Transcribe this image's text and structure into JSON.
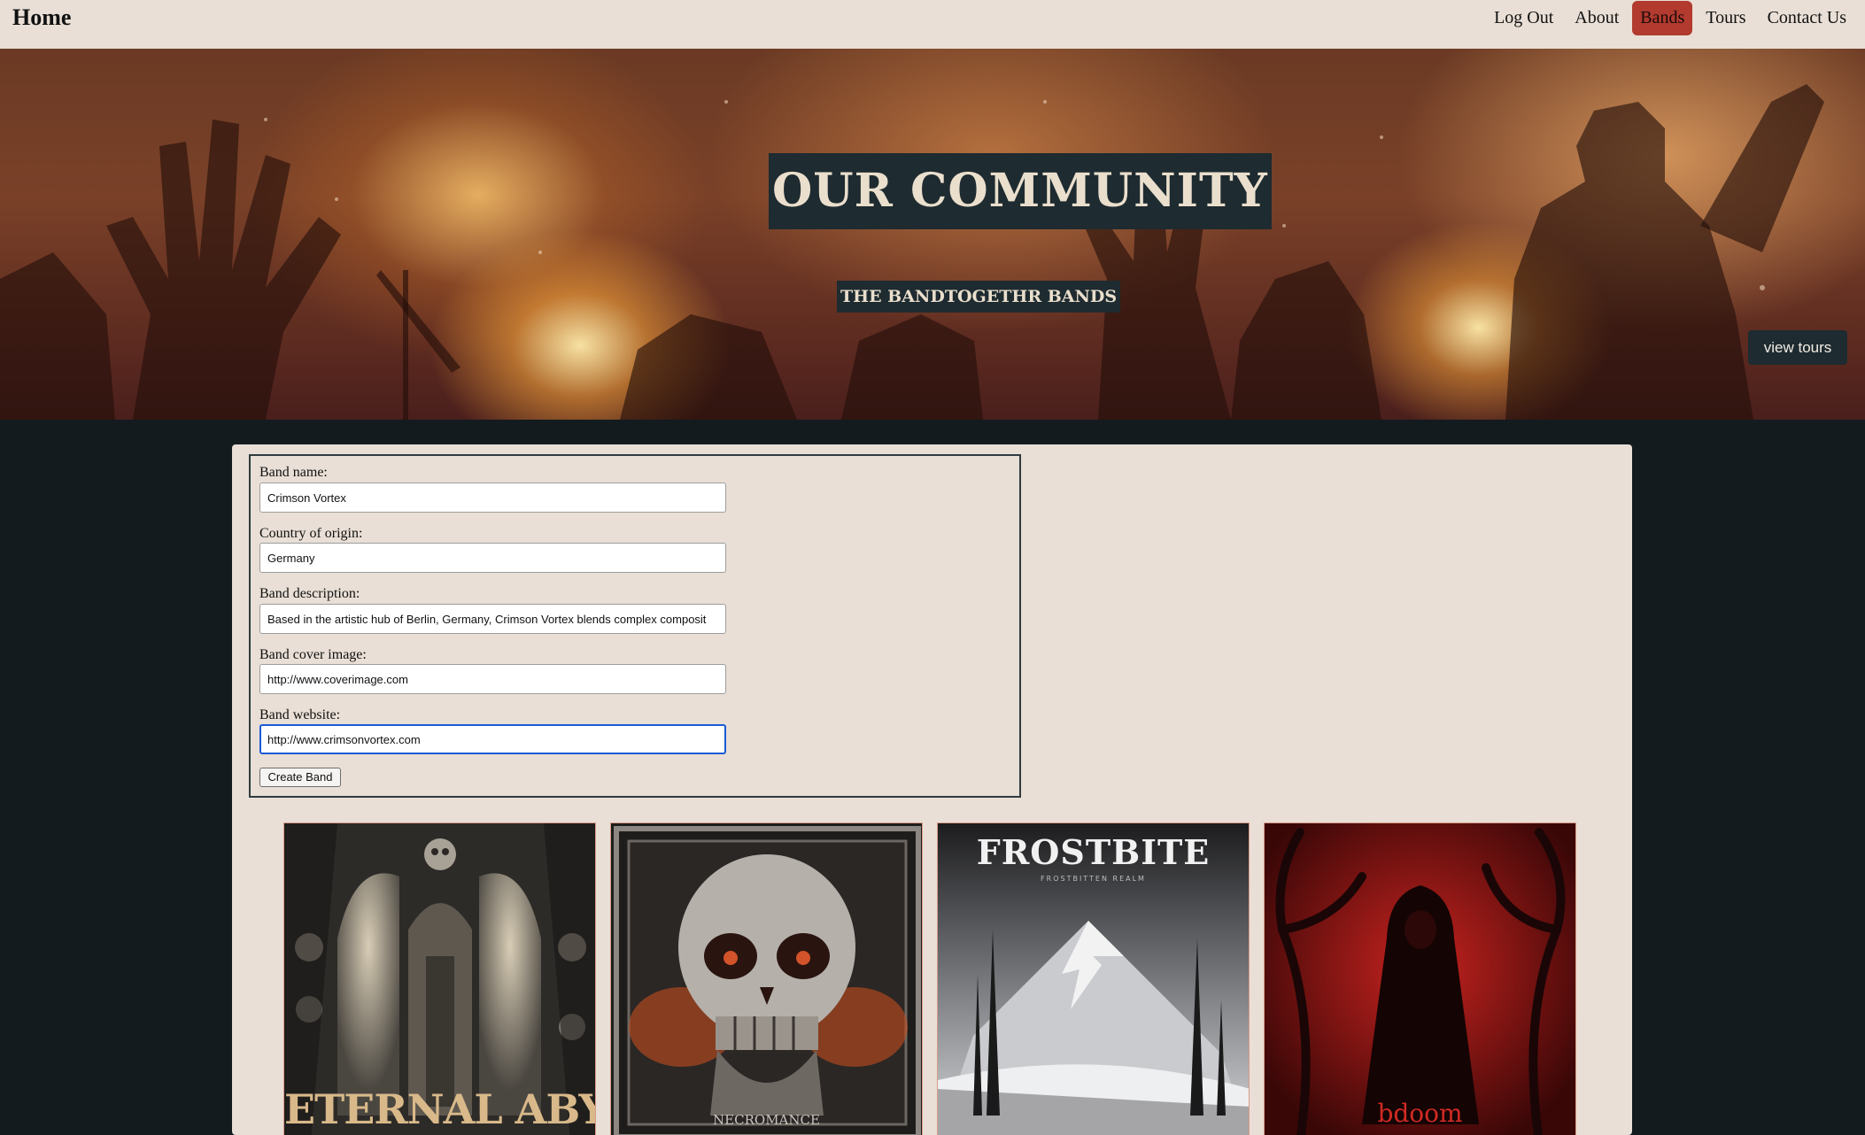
{
  "nav": {
    "home_label": "Home",
    "links": [
      "Log Out",
      "About",
      "Bands",
      "Tours",
      "Contact Us"
    ],
    "active_link": "Bands"
  },
  "hero": {
    "title": "OUR COMMUNITY",
    "subtitle": "THE BANDTOGETHR BANDS",
    "view_tours_label": "view tours"
  },
  "form": {
    "band_name": {
      "label": "Band name:",
      "value": "Crimson Vortex"
    },
    "country": {
      "label": "Country of origin:",
      "value": "Germany"
    },
    "description": {
      "label": "Band description:",
      "value": "Based in the artistic hub of Berlin, Germany, Crimson Vortex blends complex composit"
    },
    "cover_image": {
      "label": "Band cover image:",
      "value": "http://www.coverimage.com"
    },
    "website": {
      "label": "Band website:",
      "value": "http://www.crimsonvortex.com"
    },
    "submit_label": "Create Band"
  },
  "bands": [
    {
      "cover_text": "ETERNAL ABYSS",
      "cover_subtext": ""
    },
    {
      "cover_text": "NECROMANCE",
      "cover_subtext": ""
    },
    {
      "cover_text": "FROSTBITE",
      "cover_subtext": "FROSTBITTEN REALM"
    },
    {
      "cover_text": "bdoom",
      "cover_subtext": ""
    }
  ],
  "colors": {
    "nav_bg": "#e9dfd6",
    "active_nav": "#b23a2f",
    "page_bg": "#131b1f",
    "panel_bg": "#e9dfd6",
    "hero_label_bg": "#1e2b30",
    "focus_ring": "#1a5bd6"
  }
}
